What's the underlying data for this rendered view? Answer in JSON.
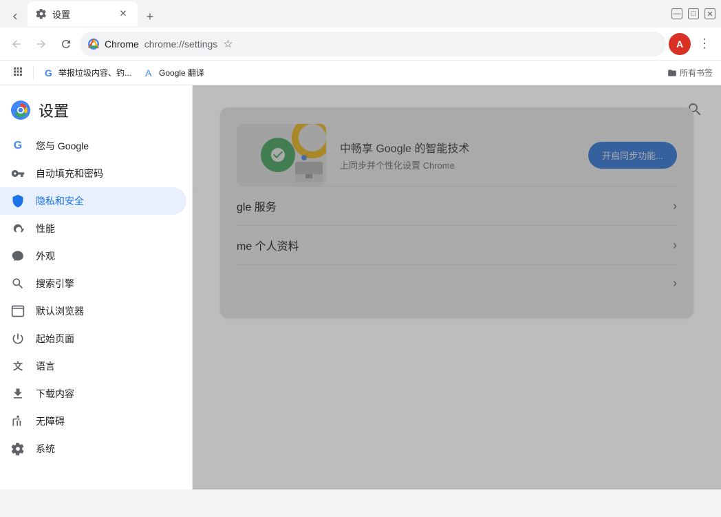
{
  "titlebar": {
    "tab_title": "设置",
    "tab_favicon": "⚙",
    "new_tab_label": "+",
    "minimize": "—",
    "maximize": "□",
    "close": "✕"
  },
  "toolbar": {
    "back_title": "后退",
    "forward_title": "前进",
    "reload_title": "重新加载",
    "chrome_label": "Chrome",
    "url": "chrome://settings",
    "bookmark_title": "将此标签页加入书签",
    "profile_label": "A",
    "more_title": "更多"
  },
  "bookmarks": {
    "items": [
      {
        "icon": "G",
        "label": "举报垃圾内容、钓..."
      },
      {
        "icon": "A",
        "label": "Google 翻译"
      }
    ],
    "all_bookmarks": "所有书签"
  },
  "sidebar": {
    "title": "设置",
    "items": [
      {
        "id": "google",
        "label": "您与 Google",
        "icon": "G"
      },
      {
        "id": "autofill",
        "label": "自动填充和密码",
        "icon": "🔑"
      },
      {
        "id": "privacy",
        "label": "隐私和安全",
        "icon": "🛡"
      },
      {
        "id": "performance",
        "label": "性能",
        "icon": "💿"
      },
      {
        "id": "appearance",
        "label": "外观",
        "icon": "🎨"
      },
      {
        "id": "search",
        "label": "搜索引擎",
        "icon": "🔍"
      },
      {
        "id": "default-browser",
        "label": "默认浏览器",
        "icon": "⬜"
      },
      {
        "id": "startup",
        "label": "起始页面",
        "icon": "⏻"
      },
      {
        "id": "language",
        "label": "语言",
        "icon": "文"
      },
      {
        "id": "downloads",
        "label": "下载内容",
        "icon": "⬇"
      },
      {
        "id": "accessibility",
        "label": "无障碍",
        "icon": "♿"
      },
      {
        "id": "system",
        "label": "系统",
        "icon": "⚙"
      }
    ]
  },
  "content": {
    "search_title": "搜索设置",
    "sync_card": {
      "main_text": "中畅享 Google 的智能技术",
      "sub_text": "上同步并个性化设置 Chrome",
      "button_label": "开启同步功能..."
    },
    "list_items": [
      {
        "label": "gle 服务"
      },
      {
        "label": "me 个人资料"
      },
      {
        "label": ""
      }
    ]
  },
  "arrow": {
    "color": "#e53935"
  }
}
